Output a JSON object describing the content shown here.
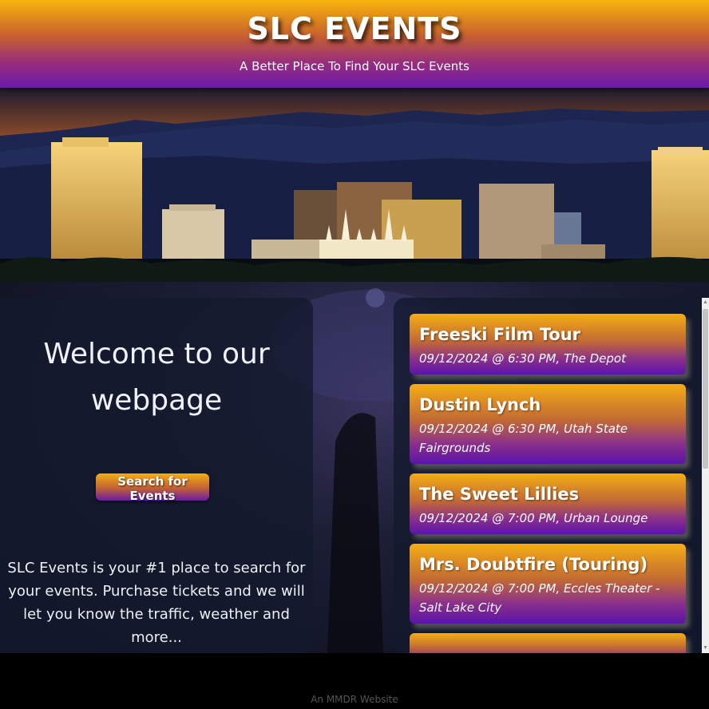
{
  "header": {
    "title": "SLC EVENTS",
    "tagline": "A Better Place To Find Your SLC Events"
  },
  "welcome": {
    "heading": "Welcome to our webpage",
    "search_button": "Search for Events",
    "description": "SLC Events is your #1 place to search for your events. Purchase tickets and we will let you know the traffic, weather and more..."
  },
  "events": [
    {
      "name": "Freeski Film Tour",
      "details": "09/12/2024 @ 6:30 PM, The Depot"
    },
    {
      "name": "Dustin Lynch",
      "details": "09/12/2024 @ 6:30 PM, Utah State Fairgrounds"
    },
    {
      "name": "The Sweet Lillies",
      "details": "09/12/2024 @ 7:00 PM, Urban Lounge"
    },
    {
      "name": "Mrs. Doubtfire (Touring)",
      "details": "09/12/2024 @ 7:00 PM, Eccles Theater - Salt Lake City"
    }
  ],
  "footer": {
    "text": "An MMDR Website"
  },
  "colors": {
    "gradient_top": "#f8b40c",
    "gradient_bottom": "#6a1aa8",
    "panel_bg": "#141a2d"
  },
  "icons": {
    "scroll_up": "triangle-up",
    "scroll_down": "triangle-down"
  }
}
